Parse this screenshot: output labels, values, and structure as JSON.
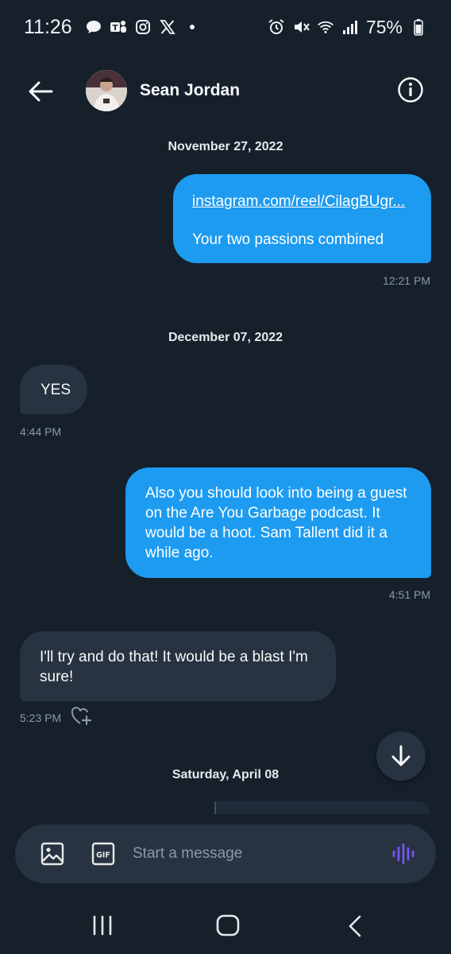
{
  "status_bar": {
    "time": "11:26",
    "battery": "75%",
    "left_icons": [
      "chat-bubble-icon",
      "teams-icon",
      "instagram-icon",
      "x-icon",
      "dot-icon"
    ],
    "right_icons": [
      "alarm-icon",
      "mute-icon",
      "wifi-icon",
      "signal-icon",
      "battery-icon"
    ]
  },
  "header": {
    "contact_name": "Sean Jordan"
  },
  "conversation": {
    "date_1": "November 27, 2022",
    "msg_1": {
      "link": "instagram.com/reel/CilagBUgr...",
      "text": "Your two passions combined",
      "time": "12:21 PM"
    },
    "date_2": "December 07, 2022",
    "msg_2": {
      "text": "YES",
      "time": "4:44 PM"
    },
    "msg_3": {
      "text": "Also you should look into being a guest on the Are You Garbage podcast. It would be a hoot. Sam Tallent did it a while ago.",
      "time": "4:51 PM"
    },
    "msg_4": {
      "text": "I'll try and do that! It would be a blast I'm sure!",
      "time": "5:23 PM"
    },
    "date_3": "Saturday, April 08"
  },
  "composer": {
    "placeholder": "Start a message",
    "gif_label": "GIF"
  },
  "colors": {
    "background": "#15202b",
    "outgoing_bubble": "#1d9bf0",
    "incoming_bubble": "#273340",
    "voice_accent": "#7856ff"
  }
}
